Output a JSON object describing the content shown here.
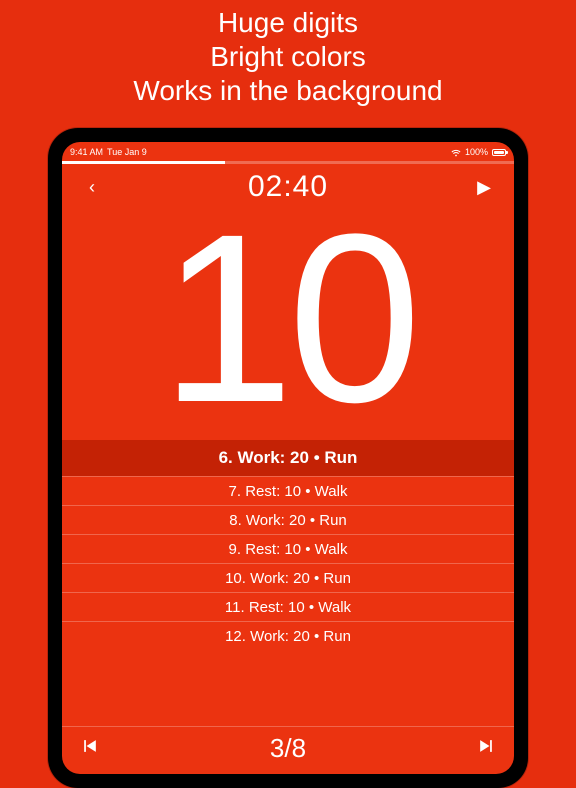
{
  "promo": {
    "line1": "Huge digits",
    "line2": "Bright colors",
    "line3": "Works in the background"
  },
  "statusbar": {
    "time": "9:41 AM",
    "date": "Tue Jan 9",
    "battery_pct": "100%"
  },
  "progress": {
    "percent": 36
  },
  "header": {
    "back_glyph": "‹",
    "elapsed": "02:40",
    "play_glyph": "▶"
  },
  "countdown": "10",
  "intervals": {
    "current": "6. Work: 20 • Run",
    "upcoming": [
      "7. Rest: 10 • Walk",
      "8. Work: 20 • Run",
      "9. Rest: 10 • Walk",
      "10. Work: 20 • Run",
      "11. Rest: 10 • Walk",
      "12. Work: 20 • Run"
    ]
  },
  "footer": {
    "counter": "3/8"
  }
}
